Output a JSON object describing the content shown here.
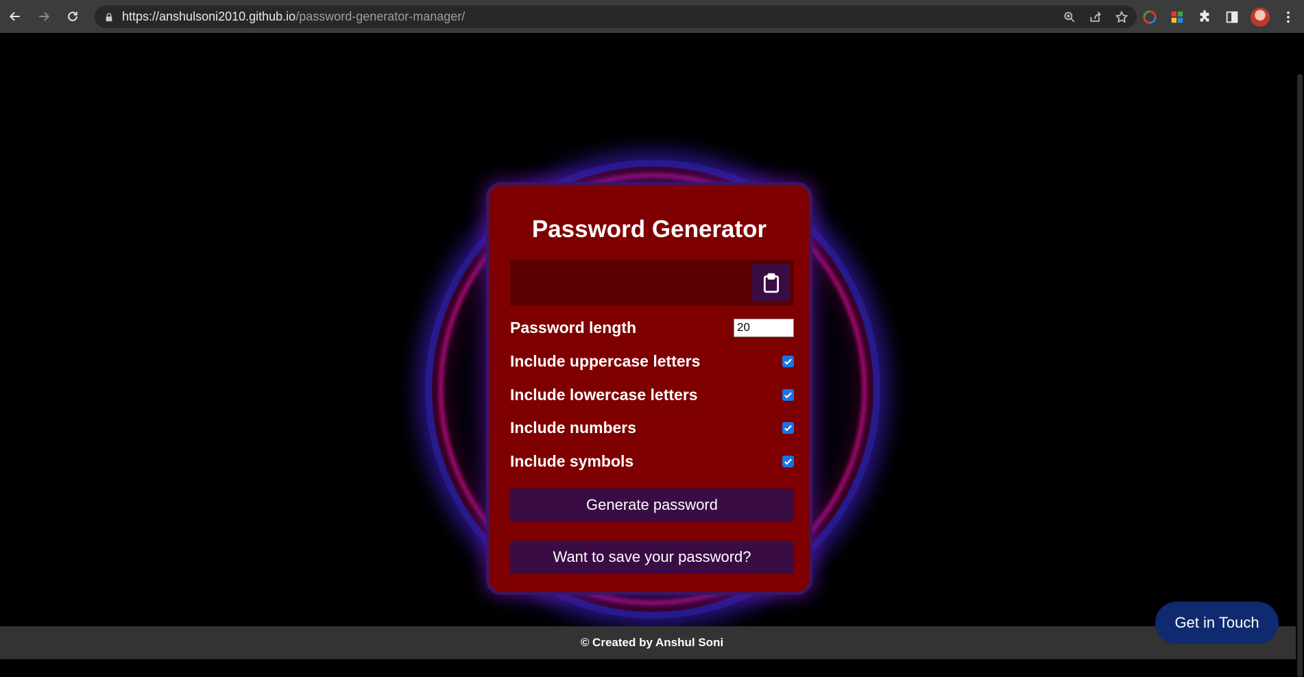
{
  "browser": {
    "url_host": "https://anshulsoni2010.github.io",
    "url_path": "/password-generator-manager/"
  },
  "app": {
    "title": "Password Generator",
    "password_value": "",
    "length_label": "Password length",
    "length_value": "20",
    "options": [
      {
        "label": "Include uppercase letters",
        "checked": true
      },
      {
        "label": "Include lowercase letters",
        "checked": true
      },
      {
        "label": "Include numbers",
        "checked": true
      },
      {
        "label": "Include symbols",
        "checked": true
      }
    ],
    "generate_label": "Generate password",
    "save_label": "Want to save your password?"
  },
  "footer": {
    "text": "© Created by Anshul Soni"
  },
  "contact": {
    "label": "Get in Touch"
  },
  "colors": {
    "card_bg": "#7f0000",
    "button_bg": "#3a0c44",
    "contact_bg": "#0f2a6e",
    "checkbox_accent": "#1a73e8"
  }
}
